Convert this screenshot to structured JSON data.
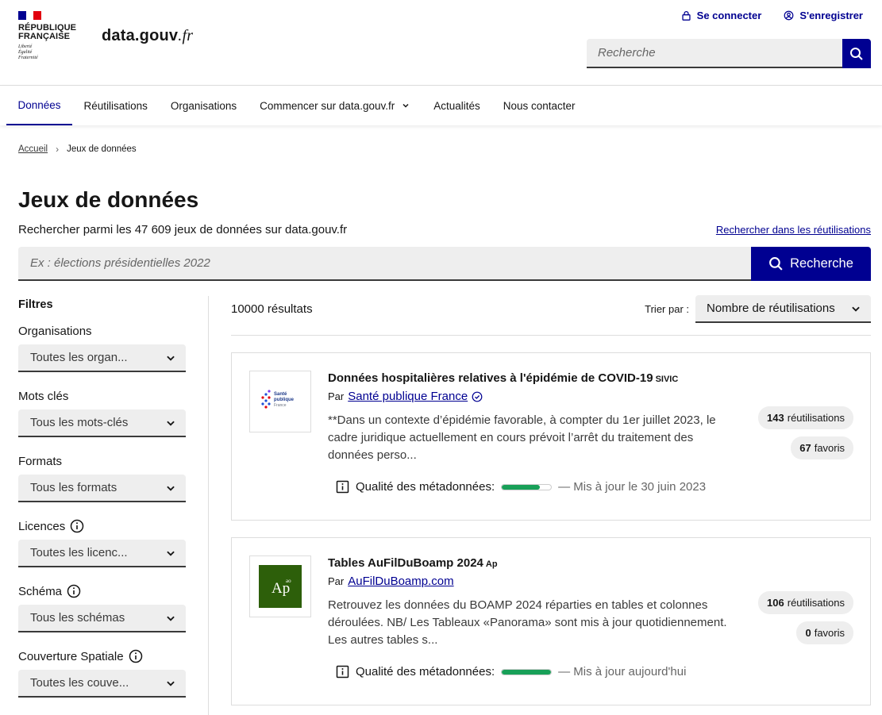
{
  "header": {
    "gov_brand_line1": "République",
    "gov_brand_line2": "Française",
    "motto_1": "Liberté",
    "motto_2": "Égalité",
    "motto_3": "Fraternité",
    "site_name_main": "data.gouv",
    "site_name_suffix": ".fr",
    "login_label": "Se connecter",
    "register_label": "S'enregistrer",
    "search_placeholder": "Recherche"
  },
  "nav": {
    "items": [
      {
        "label": "Données"
      },
      {
        "label": "Réutilisations"
      },
      {
        "label": "Organisations"
      },
      {
        "label": "Commencer sur data.gouv.fr"
      },
      {
        "label": "Actualités"
      },
      {
        "label": "Nous contacter"
      }
    ]
  },
  "breadcrumb": {
    "home": "Accueil",
    "current": "Jeux de données"
  },
  "page": {
    "title": "Jeux de données",
    "subtitle": "Rechercher parmi les 47 609 jeux de données sur data.gouv.fr",
    "reuse_search_link": "Rechercher dans les réutilisations",
    "search_placeholder": "Ex : élections présidentielles 2022",
    "search_button": "Recherche"
  },
  "sidebar": {
    "title": "Filtres",
    "filters": [
      {
        "label": "Organisations",
        "value": "Toutes les organ..."
      },
      {
        "label": "Mots clés",
        "value": "Tous les mots-clés"
      },
      {
        "label": "Formats",
        "value": "Tous les formats"
      },
      {
        "label": "Licences",
        "value": "Toutes les licenc..."
      },
      {
        "label": "Schéma",
        "value": "Tous les schémas"
      },
      {
        "label": "Couverture Spatiale",
        "value": "Toutes les couve..."
      }
    ]
  },
  "results": {
    "count": "10000 résultats",
    "sort_label": "Trier par :",
    "sort_value": "Nombre de réutilisations",
    "items": [
      {
        "title": "Données hospitalières relatives à l'épidémie de COVID-19",
        "acronym": "sivic",
        "by": "Par",
        "org": "Santé publique France",
        "logo_text_1": "Santé",
        "logo_text_2": "publique",
        "logo_text_3": "France",
        "description": "**Dans un contexte d’épidémie favorable, à compter du 1er juillet 2023, le cadre juridique actuellement en cours prévoit l’arrêt du traitement des données perso...",
        "quality_label": "Qualité des métadonnées:",
        "quality_fraction": 0.77,
        "updated": "— Mis à jour le 30 juin 2023",
        "reuses_count": "143",
        "reuses_label": "réutilisations",
        "favorites_count": "67",
        "favorites_label": "favoris"
      },
      {
        "title": "Tables AuFilDuBoamp 2024",
        "acronym": "Ap",
        "by": "Par",
        "org": "AuFilDuBoamp.com",
        "logo_text_1": "Ap",
        "logo_text_2": "ao",
        "description": "Retrouvez les données du BOAMP 2024 réparties en tables et colonnes déroulées. NB/ Les Tableaux «Panorama» sont mis à jour quotidiennement. Les autres tables s...",
        "quality_label": "Qualité des métadonnées:",
        "quality_fraction": 1.0,
        "updated": "— Mis à jour aujourd'hui",
        "reuses_count": "106",
        "reuses_label": "réutilisations",
        "favorites_count": "0",
        "favorites_label": "favoris"
      }
    ]
  },
  "colors": {
    "primary": "#000091",
    "quality": "#18a058",
    "logo_green": "#2d5f0a"
  }
}
